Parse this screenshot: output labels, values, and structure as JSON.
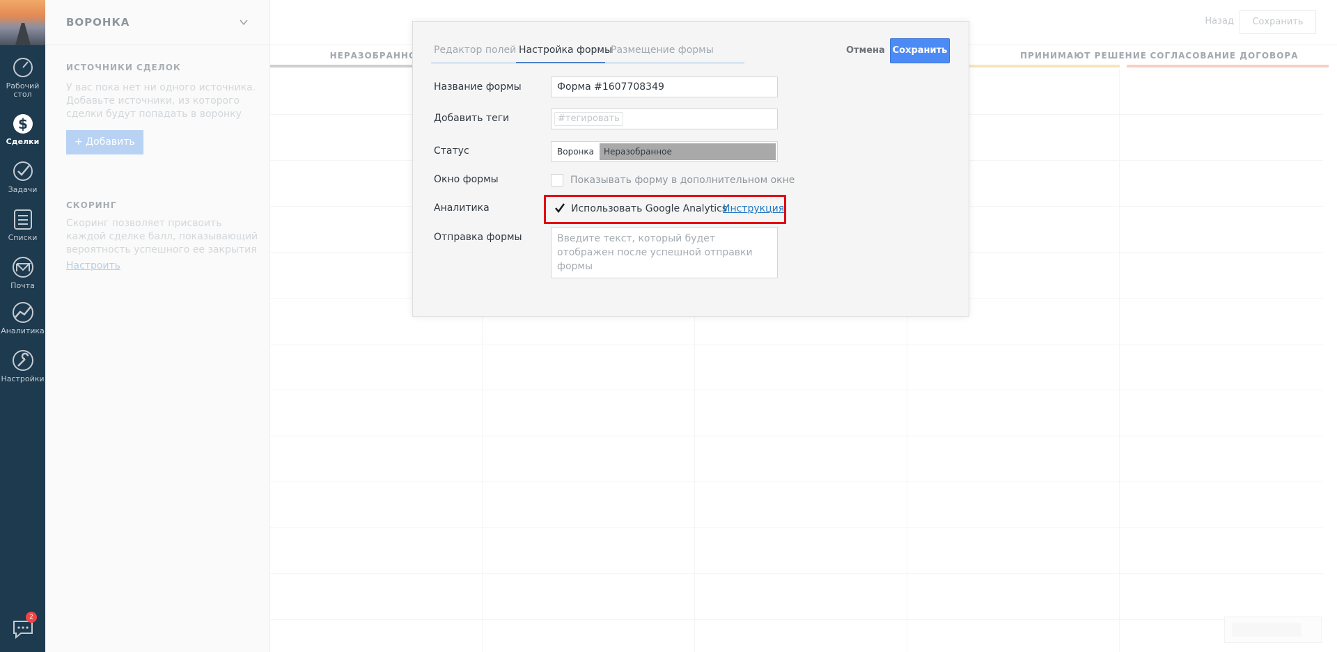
{
  "sidebar": {
    "items": [
      {
        "label": "Рабочий стол",
        "icon": "dashboard-icon"
      },
      {
        "label": "Сделки",
        "icon": "deals-icon",
        "active": true
      },
      {
        "label": "Задачи",
        "icon": "tasks-icon"
      },
      {
        "label": "Списки",
        "icon": "lists-icon"
      },
      {
        "label": "Почта",
        "icon": "mail-icon"
      },
      {
        "label": "Аналитика",
        "icon": "analytics-icon"
      },
      {
        "label": "Настройки",
        "icon": "settings-icon"
      }
    ],
    "chat_badge": "2"
  },
  "panel": {
    "title": "ВОРОНКА",
    "sources": {
      "title": "ИСТОЧНИКИ СДЕЛОК",
      "text": "У вас пока нет ни одного источника. Добавьте источники, из которого сделки будут попадать в воронку",
      "add_label": "+ Добавить"
    },
    "scoring": {
      "title": "СКОРИНГ",
      "text": "Скоринг позволяет присвоить каждой сделке балл, показывающий вероятность успешного ее закрытия",
      "link": "Настроить"
    }
  },
  "board": {
    "back": "Назад",
    "save": "Сохранить",
    "columns": [
      {
        "title": "НЕРАЗОБРАННОЕ",
        "color": "#cfcfcf"
      },
      {
        "title": "ПРИНИМАЮТ РЕШЕНИЕ",
        "color": "#f9e4b6"
      },
      {
        "title": "СОГЛАСОВАНИЕ ДОГОВОРА",
        "color": "#f8cfc3"
      }
    ]
  },
  "modal": {
    "tabs": [
      "Редактор полей",
      "Настройка формы",
      "Размещение формы"
    ],
    "active_tab": 1,
    "cancel": "Отмена",
    "save": "Сохранить",
    "fields": {
      "name_label": "Название формы",
      "name_value": "Форма #1607708349",
      "tags_label": "Добавить теги",
      "tags_placeholder": "#тегировать",
      "status_label": "Статус",
      "status_funnel": "Воронка",
      "status_stage": "Неразобранное",
      "window_label": "Окно формы",
      "window_checkbox": "Показывать форму в дополнительном окне",
      "analytics_label": "Аналитика",
      "analytics_checkbox": "Использовать Google Analytics",
      "analytics_checked": true,
      "analytics_link": "Инструкция",
      "submit_label": "Отправка формы",
      "submit_placeholder": "Введите текст, который будет отображен после успешной отправки формы"
    }
  },
  "colors": {
    "sidebar_bg": "#1d3a4e",
    "primary_button": "#4c8bf5",
    "highlight": "#e30613",
    "link": "#1f77c0"
  }
}
